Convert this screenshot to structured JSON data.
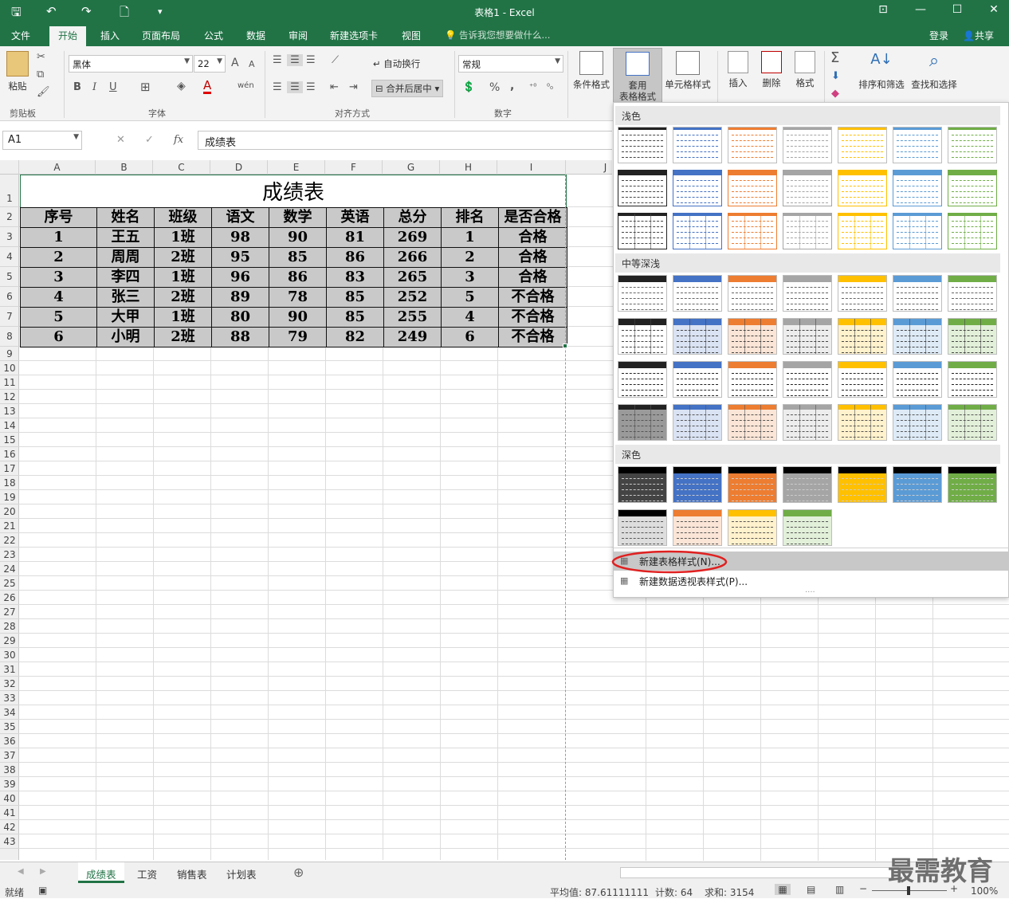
{
  "titlebar": {
    "title": "表格1 - Excel",
    "qa_save": "🖫",
    "qa_undo": "↶",
    "qa_redo": "↷",
    "qa_new": "🗋",
    "qa_customize": "▾",
    "ctrl_ribbon": "⊡",
    "ctrl_min": "—",
    "ctrl_max": "☐",
    "ctrl_close": "✕"
  },
  "tabs": {
    "file": "文件",
    "home": "开始",
    "insert": "插入",
    "layout": "页面布局",
    "formulas": "公式",
    "data": "数据",
    "review": "审阅",
    "newtab": "新建选项卡",
    "view": "视图",
    "tellme": "告诉我您想要做什么...",
    "login": "登录",
    "share": "共享"
  },
  "ribbon": {
    "clipboard": {
      "paste": "粘贴",
      "group": "剪贴板"
    },
    "font": {
      "name": "黑体",
      "size": "22",
      "bold": "B",
      "italic": "I",
      "underline": "U",
      "group": "字体",
      "grow": "A",
      "shrink": "A",
      "wen": "wén"
    },
    "align": {
      "wrap": "自动换行",
      "merge": "合并后居中",
      "group": "对齐方式"
    },
    "number": {
      "format": "常规",
      "percent": "%",
      "comma": ",",
      "group": "数字"
    },
    "styles": {
      "cond": "条件格式",
      "table_fmt_line1": "套用",
      "table_fmt_line2": "表格格式",
      "cell_styles": "单元格样式"
    },
    "cells": {
      "insert": "插入",
      "delete": "删除",
      "format": "格式"
    },
    "editing": {
      "sort": "排序和筛选",
      "find": "查找和选择",
      "sigma": "Σ"
    }
  },
  "formula_bar": {
    "namebox": "A1",
    "cancel": "✕",
    "enter": "✓",
    "fx": "fx",
    "value": "成绩表"
  },
  "col_headers": [
    "A",
    "B",
    "C",
    "D",
    "E",
    "F",
    "G",
    "H",
    "I",
    "J"
  ],
  "row_headers": [
    "1",
    "2",
    "3",
    "4",
    "5",
    "6",
    "7",
    "8",
    "9",
    "10",
    "11",
    "12",
    "13",
    "14",
    "15",
    "16",
    "17",
    "18",
    "19",
    "20",
    "21",
    "22",
    "23",
    "24",
    "25",
    "26",
    "27",
    "28",
    "29",
    "30",
    "31",
    "32",
    "33",
    "34",
    "35",
    "36",
    "37",
    "38",
    "39",
    "40",
    "41",
    "42",
    "43"
  ],
  "sheet": {
    "title": "成绩表",
    "headers": [
      "序号",
      "姓名",
      "班级",
      "语文",
      "数学",
      "英语",
      "总分",
      "排名",
      "是否合格"
    ],
    "rows": [
      [
        "1",
        "王五",
        "1班",
        "98",
        "90",
        "81",
        "269",
        "1",
        "合格"
      ],
      [
        "2",
        "周周",
        "2班",
        "95",
        "85",
        "86",
        "266",
        "2",
        "合格"
      ],
      [
        "3",
        "李四",
        "1班",
        "96",
        "86",
        "83",
        "265",
        "3",
        "合格"
      ],
      [
        "4",
        "张三",
        "2班",
        "89",
        "78",
        "85",
        "252",
        "5",
        "不合格"
      ],
      [
        "5",
        "大甲",
        "1班",
        "80",
        "90",
        "85",
        "255",
        "4",
        "不合格"
      ],
      [
        "6",
        "小明",
        "2班",
        "88",
        "79",
        "82",
        "249",
        "6",
        "不合格"
      ]
    ]
  },
  "gallery": {
    "light": "浅色",
    "medium": "中等深浅",
    "dark": "深色",
    "new_table_style": "新建表格样式(N)...",
    "new_pivot_style": "新建数据透视表样式(P)...",
    "dots": "....",
    "accents": [
      "#222222",
      "#4472c4",
      "#ed7d31",
      "#a5a5a5",
      "#ffc000",
      "#5b9bd5",
      "#70ad47"
    ],
    "light_fills": [
      "#ffffff",
      "#dae3f3",
      "#fbe5d6",
      "#ededed",
      "#fff2cc",
      "#deebf7",
      "#e2f0d9"
    ]
  },
  "sheet_tabs": [
    "成绩表",
    "工资",
    "销售表",
    "计划表"
  ],
  "add_sheet": "⊕",
  "status": {
    "ready": "就绪",
    "average": "平均值: 87.61111111",
    "count": "计数: 64",
    "sum": "求和: 3154",
    "zoom": "100%"
  },
  "watermark": "最需教育"
}
